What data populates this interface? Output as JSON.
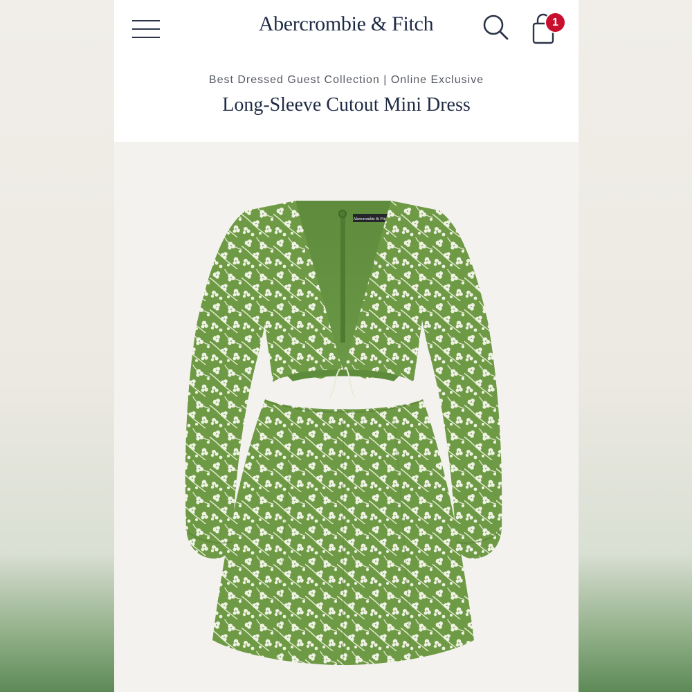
{
  "header": {
    "brand": "Abercrombie & Fitch",
    "bag_count": "1",
    "menu_icon": "hamburger-menu-icon",
    "search_icon": "search-icon",
    "bag_icon": "shopping-bag-icon"
  },
  "product": {
    "collection": "Best Dressed Guest Collection | Online Exclusive",
    "title": "Long-Sleeve Cutout Mini Dress",
    "garment_label": "Abercrombie & Fitch",
    "image_description": "Green floral long-sleeve cutout mini dress with white flower print",
    "colors": {
      "dress_green": "#6f9a45",
      "lining_green": "#5e8c3c",
      "flower_white": "#eef2e2"
    }
  },
  "colors": {
    "brand_navy": "#1e2a44",
    "badge_red": "#c8102e"
  }
}
